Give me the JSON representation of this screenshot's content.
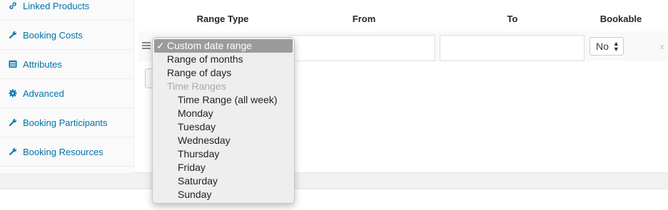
{
  "sidebar": {
    "items": [
      {
        "label": "Linked Products",
        "icon": "link-icon"
      },
      {
        "label": "Booking Costs",
        "icon": "wrench-icon"
      },
      {
        "label": "Attributes",
        "icon": "list-icon"
      },
      {
        "label": "Advanced",
        "icon": "gear-icon"
      },
      {
        "label": "Booking Participants",
        "icon": "wrench-icon"
      },
      {
        "label": "Booking Resources",
        "icon": "wrench-icon"
      }
    ]
  },
  "table": {
    "headers": {
      "range_type": "Range Type",
      "from": "From",
      "to": "To",
      "bookable": "Bookable"
    },
    "row": {
      "bookable_value": "No",
      "remove_label": "x"
    }
  },
  "dropdown": {
    "selected_check": "✓",
    "options": [
      {
        "label": "Custom date range",
        "state": "selected"
      },
      {
        "label": "Range of months"
      },
      {
        "label": "Range of days"
      },
      {
        "label": "Time Ranges",
        "state": "group"
      },
      {
        "label": "Time Range (all week)",
        "state": "indent"
      },
      {
        "label": "Monday",
        "state": "indent"
      },
      {
        "label": "Tuesday",
        "state": "indent"
      },
      {
        "label": "Wednesday",
        "state": "indent"
      },
      {
        "label": "Thursday",
        "state": "indent"
      },
      {
        "label": "Friday",
        "state": "indent"
      },
      {
        "label": "Saturday",
        "state": "indent"
      },
      {
        "label": "Sunday",
        "state": "indent"
      }
    ]
  },
  "colors": {
    "link": "#0073aa",
    "selected_bg": "#9b9b9b",
    "group_text": "#aaaaaa"
  }
}
